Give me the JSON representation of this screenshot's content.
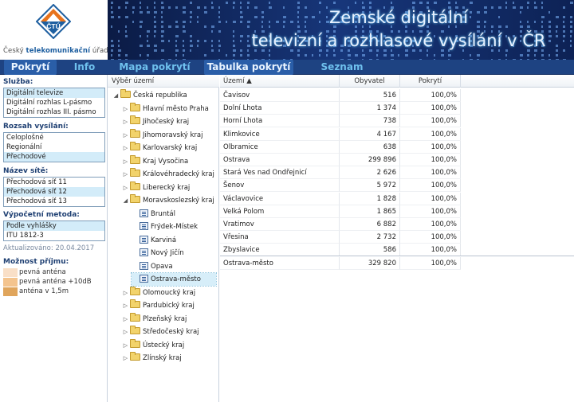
{
  "logo": {
    "text_pre": "Český ",
    "text_bold": "telekomunikační",
    "text_post": " úřad",
    "mark": "ČTÚ"
  },
  "banner": {
    "title_line1": "Zemské digitální",
    "title_line2": "televizní a rozhlasové vysílání v ČR"
  },
  "nav": {
    "tabs": [
      "Pokrytí",
      "Info",
      "Mapa pokrytí",
      "Tabulka pokrytí",
      "Seznam vysílačů"
    ]
  },
  "sidebar": {
    "sluzba_label": "Služba:",
    "sluzba_items": [
      "Digitální televize",
      "Digitální rozhlas L-pásmo",
      "Digitální rozhlas III. pásmo"
    ],
    "rozsah_label": "Rozsah vysílání:",
    "rozsah_items": [
      "Celoplošné",
      "Regionální",
      "Přechodové"
    ],
    "sit_label": "Název sítě:",
    "sit_items": [
      "Přechodová síť 11",
      "Přechodová síť 12",
      "Přechodová síť 13"
    ],
    "metoda_label": "Výpočetní metoda:",
    "metoda_items": [
      "Podle vyhlášky",
      "ITU 1812-3"
    ],
    "updated": "Aktualizováno: 20.04.2017",
    "legend_title": "Možnost příjmu:",
    "legend": [
      {
        "label": "pevná anténa",
        "color": "#f9dfc7"
      },
      {
        "label": "pevná anténa +10dB",
        "color": "#f4c48e"
      },
      {
        "label": "anténa v 1,5m",
        "color": "#e0a55c"
      }
    ],
    "colors": {
      "selected": "#d3ecf9",
      "label": "#1e3f72"
    }
  },
  "tree": {
    "header": "Výběr území",
    "nodes": [
      {
        "label": "Česká republika",
        "level": 0,
        "twisty": "◢",
        "icon": "folder-icon"
      },
      {
        "label": "Hlavní město Praha",
        "level": 1,
        "twisty": "▷",
        "icon": "folder-icon"
      },
      {
        "label": "Jihočeský kraj",
        "level": 1,
        "twisty": "▷",
        "icon": "folder-icon"
      },
      {
        "label": "Jihomoravský kraj",
        "level": 1,
        "twisty": "▷",
        "icon": "folder-icon"
      },
      {
        "label": "Karlovarský kraj",
        "level": 1,
        "twisty": "▷",
        "icon": "folder-icon"
      },
      {
        "label": "Kraj Vysočina",
        "level": 1,
        "twisty": "▷",
        "icon": "folder-icon"
      },
      {
        "label": "Královéhradecký kraj",
        "level": 1,
        "twisty": "▷",
        "icon": "folder-icon"
      },
      {
        "label": "Liberecký kraj",
        "level": 1,
        "twisty": "▷",
        "icon": "folder-icon"
      },
      {
        "label": "Moravskoslezský kraj",
        "level": 1,
        "twisty": "◢",
        "icon": "folder-icon"
      },
      {
        "label": "Bruntál",
        "level": 2,
        "twisty": "",
        "icon": "district-icon"
      },
      {
        "label": "Frýdek-Místek",
        "level": 2,
        "twisty": "",
        "icon": "district-icon"
      },
      {
        "label": "Karviná",
        "level": 2,
        "twisty": "",
        "icon": "district-icon"
      },
      {
        "label": "Nový Jičín",
        "level": 2,
        "twisty": "",
        "icon": "district-icon"
      },
      {
        "label": "Opava",
        "level": 2,
        "twisty": "",
        "icon": "district-icon"
      },
      {
        "label": "Ostrava-město",
        "level": 2,
        "twisty": "",
        "icon": "district-icon",
        "selected": true
      },
      {
        "label": "Olomoucký kraj",
        "level": 1,
        "twisty": "▷",
        "icon": "folder-icon"
      },
      {
        "label": "Pardubický kraj",
        "level": 1,
        "twisty": "▷",
        "icon": "folder-icon"
      },
      {
        "label": "Plzeňský kraj",
        "level": 1,
        "twisty": "▷",
        "icon": "folder-icon"
      },
      {
        "label": "Středočeský kraj",
        "level": 1,
        "twisty": "▷",
        "icon": "folder-icon"
      },
      {
        "label": "Ústecký kraj",
        "level": 1,
        "twisty": "▷",
        "icon": "folder-icon"
      },
      {
        "label": "Zlínský kraj",
        "level": 1,
        "twisty": "▷",
        "icon": "folder-icon"
      }
    ]
  },
  "grid": {
    "columns": [
      "Území ▲",
      "Obyvatel",
      "Pokrytí"
    ],
    "rows": [
      [
        "Čavisov",
        "516",
        "100,0%"
      ],
      [
        "Dolní Lhota",
        "1 374",
        "100,0%"
      ],
      [
        "Horní Lhota",
        "738",
        "100,0%"
      ],
      [
        "Klimkovice",
        "4 167",
        "100,0%"
      ],
      [
        "Olbramice",
        "638",
        "100,0%"
      ],
      [
        "Ostrava",
        "299 896",
        "100,0%"
      ],
      [
        "Stará Ves nad Ondřejnicí",
        "2 626",
        "100,0%"
      ],
      [
        "Šenov",
        "5 972",
        "100,0%"
      ],
      [
        "Václavovice",
        "1 828",
        "100,0%"
      ],
      [
        "Velká Polom",
        "1 865",
        "100,0%"
      ],
      [
        "Vratimov",
        "6 882",
        "100,0%"
      ],
      [
        "Vřesina",
        "2 732",
        "100,0%"
      ],
      [
        "Zbyslavice",
        "586",
        "100,0%"
      ]
    ],
    "total": [
      "Ostrava-město",
      "329 820",
      "100,0%"
    ]
  }
}
